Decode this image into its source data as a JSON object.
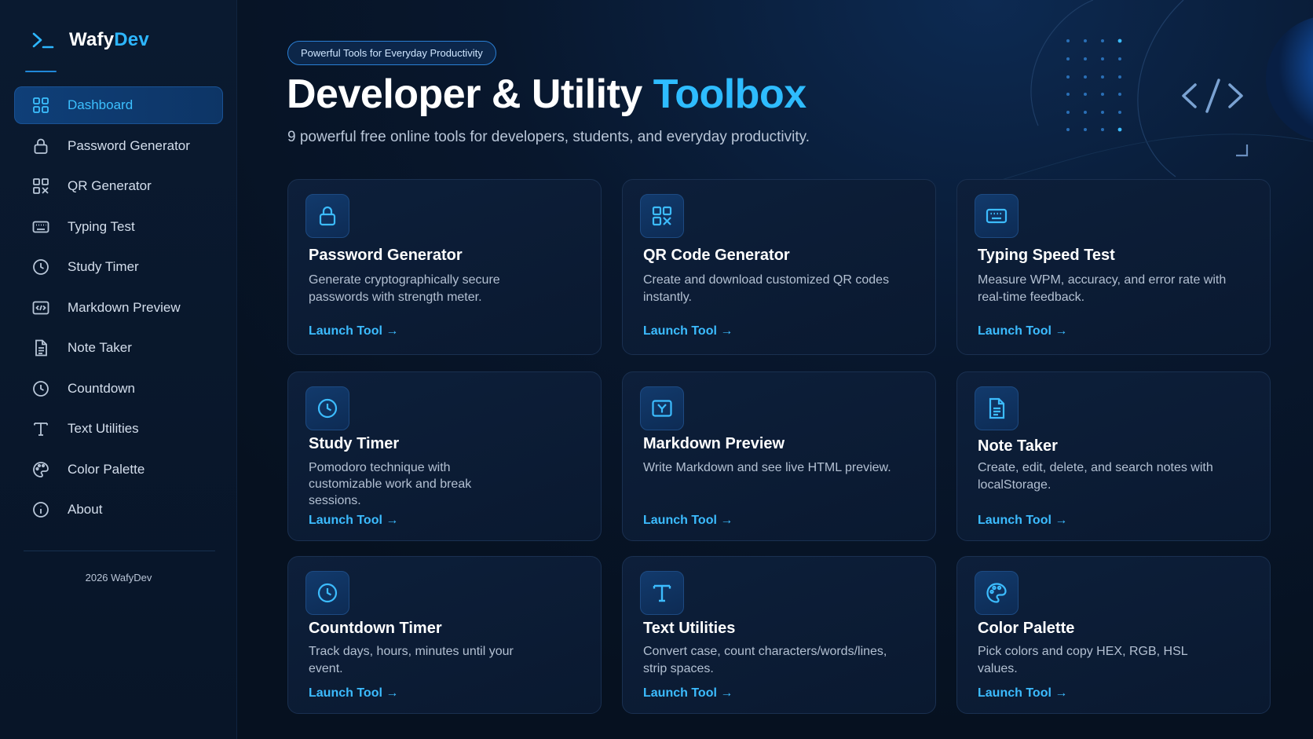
{
  "brand": {
    "name_main": "Wafy",
    "name_accent": "Dev"
  },
  "sidebar": {
    "items": [
      {
        "label": "Dashboard",
        "icon": "grid-icon",
        "active": true
      },
      {
        "label": "Password Generator",
        "icon": "lock-icon"
      },
      {
        "label": "QR Generator",
        "icon": "qr-icon"
      },
      {
        "label": "Typing Test",
        "icon": "keyboard-icon"
      },
      {
        "label": "Study Timer",
        "icon": "clock-icon"
      },
      {
        "label": "Markdown Preview",
        "icon": "code-icon"
      },
      {
        "label": "Note Taker",
        "icon": "document-icon"
      },
      {
        "label": "Countdown",
        "icon": "clock-icon"
      },
      {
        "label": "Text Utilities",
        "icon": "text-icon"
      },
      {
        "label": "Color Palette",
        "icon": "palette-icon"
      },
      {
        "label": "About",
        "icon": "info-icon"
      }
    ],
    "footer": "2026 WafyDev"
  },
  "hero": {
    "badge": "Powerful Tools for Everyday Productivity",
    "title_main": "Developer & Utility ",
    "title_accent": "Toolbox",
    "subtitle": "9 powerful free online tools for developers, students, and everyday productivity."
  },
  "cards": [
    {
      "title": "Password Generator",
      "desc": "Generate cryptographically secure passwords with strength meter.",
      "link": "Launch Tool →",
      "icon": "lock-icon"
    },
    {
      "title": "QR Code Generator",
      "desc": "Create and download customized QR codes instantly.",
      "link": "Launch Tool →",
      "icon": "qr-icon"
    },
    {
      "title": "Typing Speed Test",
      "desc": "Measure WPM, accuracy, and error rate with real-time feedback.",
      "link": "Launch Tool →",
      "icon": "keyboard-icon"
    },
    {
      "title": "Study Timer",
      "desc": "Pomodoro technique with customizable work and break sessions.",
      "link": "Launch Tool →",
      "icon": "clock-icon"
    },
    {
      "title": "Markdown Preview",
      "desc": "Write Markdown and see live HTML preview.",
      "link": "Launch Tool →",
      "icon": "markdown-icon"
    },
    {
      "title": "Note Taker",
      "desc": "Create, edit, delete, and search notes with localStorage.",
      "link": "Launch Tool →",
      "icon": "document-icon"
    },
    {
      "title": "Countdown Timer",
      "desc": "Track days, hours, minutes until your event.",
      "link": "Launch Tool →",
      "icon": "clock-icon"
    },
    {
      "title": "Text Utilities",
      "desc": "Convert case, count characters/words/lines, strip spaces.",
      "link": "Launch Tool →",
      "icon": "text-icon"
    },
    {
      "title": "Color Palette",
      "desc": "Pick colors and copy HEX, RGB, HSL values.",
      "link": "Launch Tool →",
      "icon": "palette-icon"
    }
  ],
  "colors": {
    "accent": "#2ebcff",
    "background": "#071426",
    "active_nav": "#0f3f78"
  }
}
